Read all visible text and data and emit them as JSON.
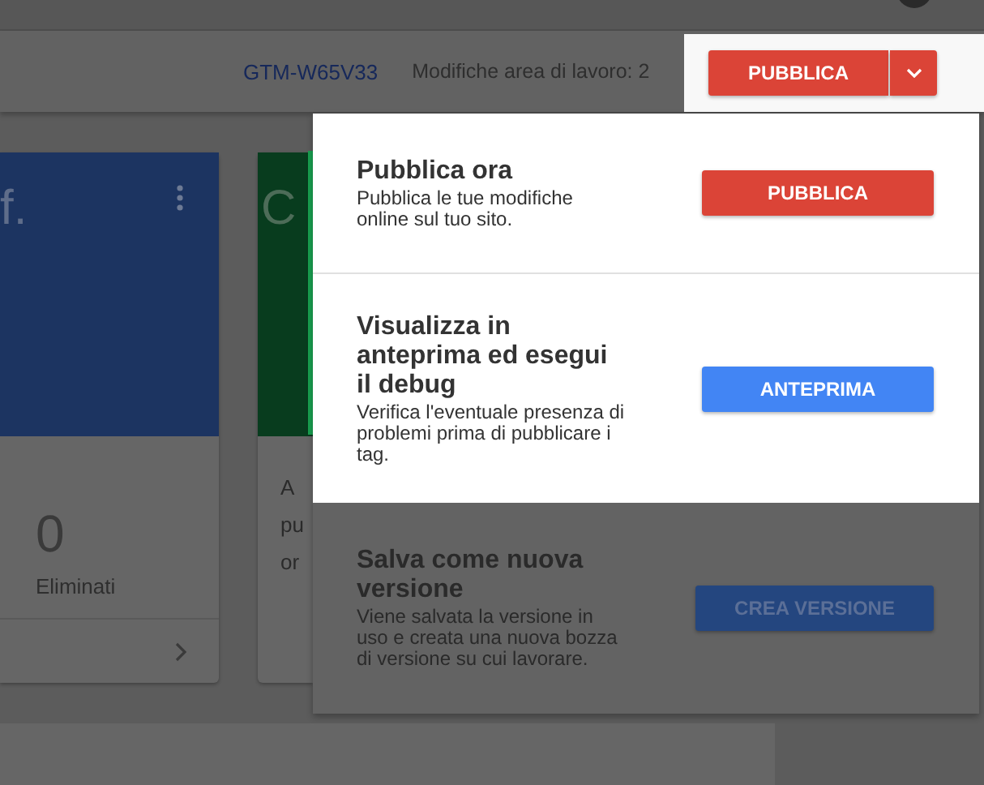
{
  "header": {
    "container_id": "GTM-W65V33",
    "workspace_changes": "Modifiche area di lavoro: 2",
    "publish_button": "PUBBLICA"
  },
  "cards": [
    {
      "title": "f.",
      "color": "#1c3461",
      "count": "0",
      "count_label": "Eliminati"
    },
    {
      "title": "C",
      "color": "#083c1e",
      "lines": [
        "A",
        "pu",
        "or"
      ]
    }
  ],
  "publish_menu": {
    "items": [
      {
        "kind": "publish",
        "highlighted": true,
        "title": "Pubblica ora",
        "description": "Pubblica le tue modifiche online sul tuo sito.",
        "button": "PUBBLICA"
      },
      {
        "kind": "preview",
        "highlighted": true,
        "title": "Visualizza in anteprima ed esegui il debug",
        "description": "Verifica l'eventuale presenza di problemi prima di pubblicare i tag.",
        "button": "ANTEPRIMA"
      },
      {
        "kind": "version",
        "highlighted": false,
        "title": "Salva come nuova versione",
        "description": "Viene salvata la versione in uso e creata una nuova bozza di versione su cui lavorare.",
        "button": "CREA VERSIONE"
      }
    ]
  }
}
